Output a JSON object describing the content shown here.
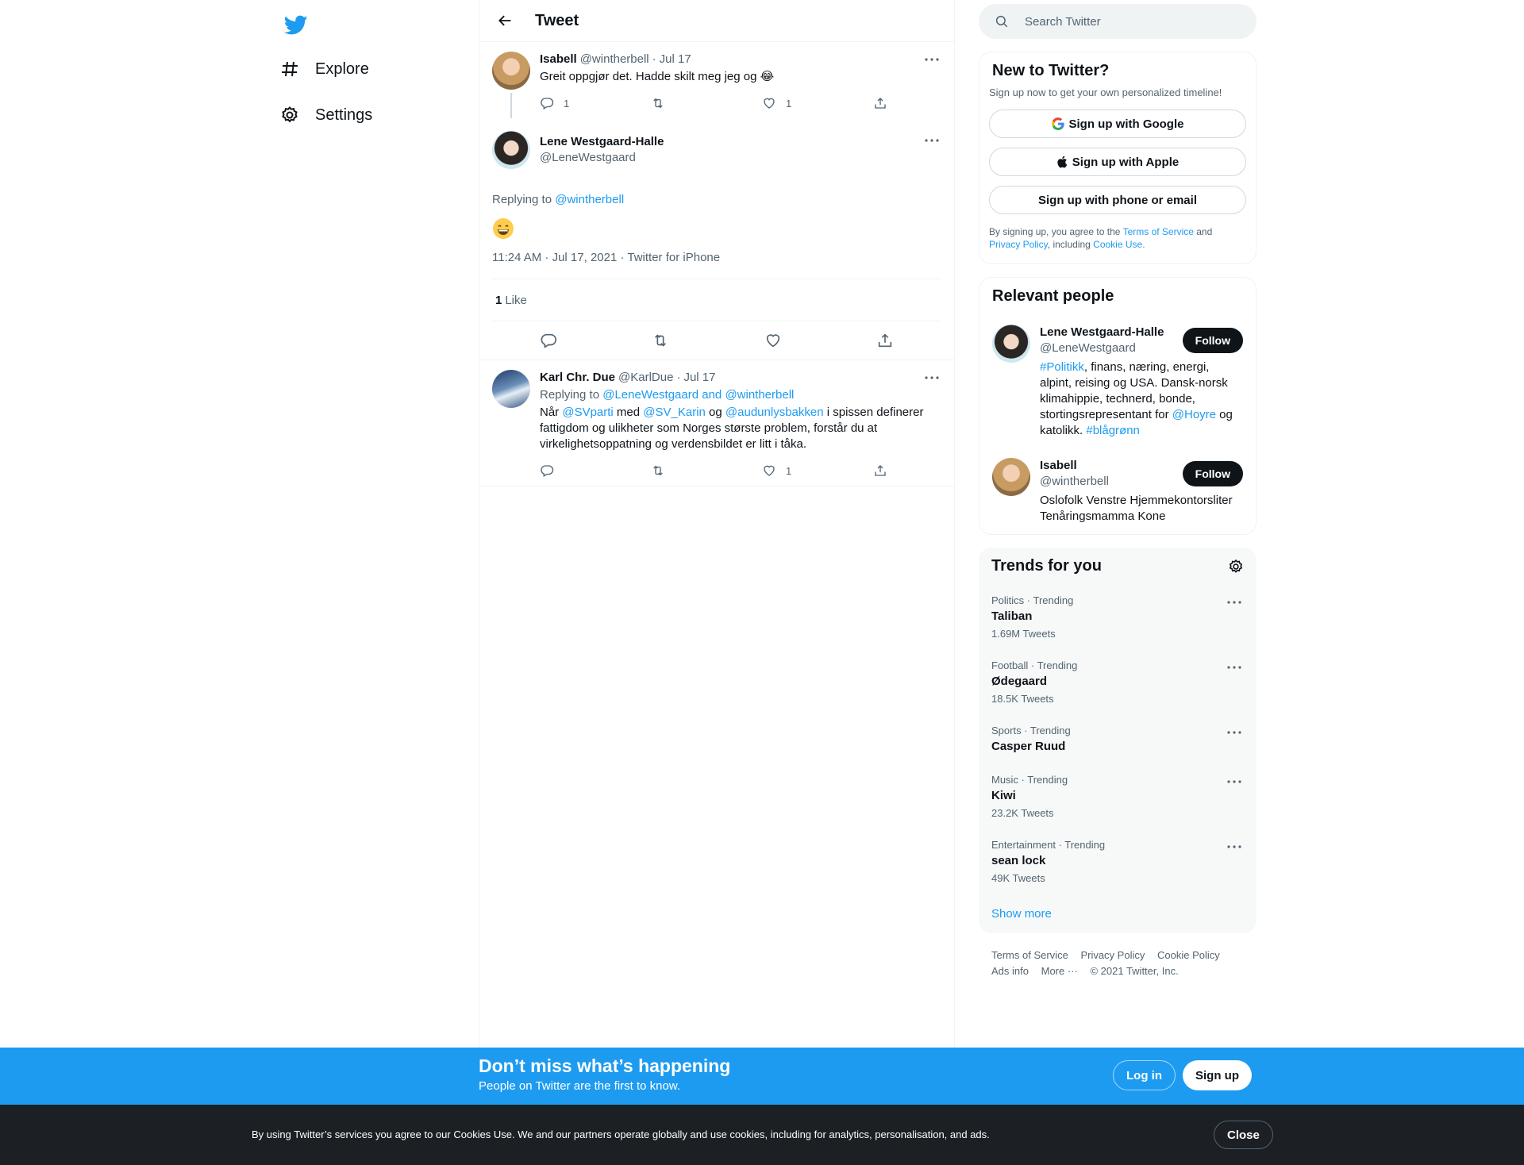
{
  "nav": {
    "explore": "Explore",
    "settings": "Settings"
  },
  "header": {
    "title": "Tweet"
  },
  "parent_tweet": {
    "name": "Isabell",
    "handle": "@wintherbell",
    "sep": "·",
    "date": "Jul 17",
    "text": "Greit oppgjør det. Hadde skilt meg jeg og 😂",
    "reply_count": "1",
    "like_count": "1"
  },
  "focal_tweet": {
    "name": "Lene Westgaard-Halle",
    "handle": "@LeneWestgaard",
    "replying_prefix": "Replying to ",
    "replying_to": "@wintherbell",
    "emoji": "😄",
    "timestamp": "11:24 AM · Jul 17, 2021 · Twitter for iPhone",
    "like_number": "1",
    "like_label": "Like"
  },
  "reply_tweet": {
    "name": "Karl Chr. Due",
    "handle": "@KarlDue",
    "sep": "·",
    "date": "Jul 17",
    "replying_prefix": "Replying to ",
    "replying_to": "@LeneWestgaard and @wintherbell",
    "text_1": "Når ",
    "mention_1": "@SVparti",
    "text_2": " med ",
    "mention_2": "@SV_Karin",
    "text_3": " og ",
    "mention_3": "@audunlysbakken",
    "text_4": " i spissen definerer fattigdom og ulikheter som Norges største problem, forstår du at virkelighetsoppatning og verdensbildet er litt i tåka.",
    "like_count": "1"
  },
  "search": {
    "placeholder": "Search Twitter"
  },
  "new_to_twitter": {
    "title": "New to Twitter?",
    "subtitle": "Sign up now to get your own personalized timeline!",
    "google": "Sign up with Google",
    "apple": "Sign up with Apple",
    "phone": "Sign up with phone or email",
    "legal_1": "By signing up, you agree to the ",
    "terms": "Terms of Service",
    "legal_2": " and ",
    "privacy": "Privacy Policy",
    "legal_3": ", including ",
    "cookie": "Cookie Use."
  },
  "relevant_people": {
    "title": "Relevant people",
    "follow_label": "Follow",
    "people": [
      {
        "name": "Lene Westgaard-Halle",
        "handle": "@LeneWestgaard",
        "bio_tag1": "#Politikk",
        "bio_1": ", finans, næring, energi, alpint, reising og USA. Dansk-norsk klimahippie, technerd, bonde, stortingsrepresentant for ",
        "bio_mention": "@Hoyre",
        "bio_2": " og katolikk. ",
        "bio_tag2": "#blågrønn"
      },
      {
        "name": "Isabell",
        "handle": "@wintherbell",
        "bio": "Oslofolk Venstre Hjemmekontorsliter Tenåringsmamma Kone"
      }
    ]
  },
  "trends": {
    "title": "Trends for you",
    "items": [
      {
        "category": "Politics · Trending",
        "name": "Taliban",
        "count": "1.69M Tweets"
      },
      {
        "category": "Football · Trending",
        "name": "Ødegaard",
        "count": "18.5K Tweets"
      },
      {
        "category": "Sports · Trending",
        "name": "Casper Ruud",
        "count": ""
      },
      {
        "category": "Music · Trending",
        "name": "Kiwi",
        "count": "23.2K Tweets"
      },
      {
        "category": "Entertainment · Trending",
        "name": "sean lock",
        "count": "49K Tweets"
      }
    ],
    "show_more": "Show more"
  },
  "footer": {
    "terms": "Terms of Service",
    "privacy": "Privacy Policy",
    "cookie": "Cookie Policy",
    "ads": "Ads info",
    "more": "More ···",
    "copyright": "© 2021 Twitter, Inc."
  },
  "signup_bar": {
    "title": "Don’t miss what’s happening",
    "subtitle": "People on Twitter are the first to know.",
    "login": "Log in",
    "signup": "Sign up"
  },
  "cookie_bar": {
    "text": "By using Twitter’s services you agree to our Cookies Use. We and our partners operate globally and use cookies, including for analytics, personalisation, and ads.",
    "close": "Close"
  },
  "colors": {
    "accent": "#1d9bf0",
    "text": "#0f1419",
    "muted": "#536471",
    "cookie_bg": "#1c1f23"
  }
}
